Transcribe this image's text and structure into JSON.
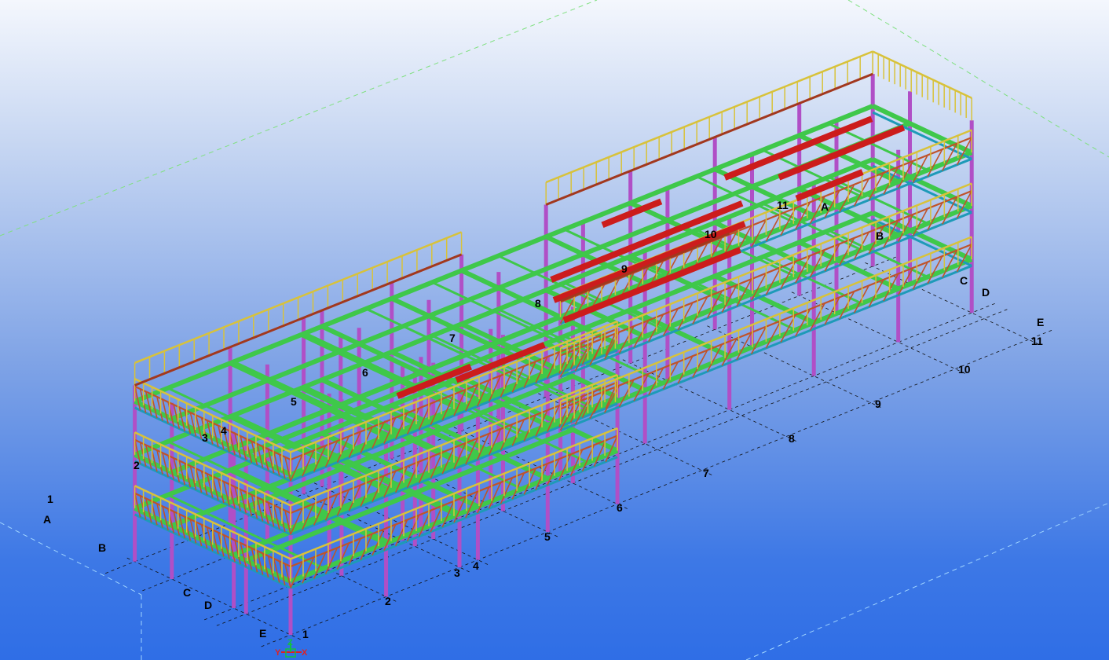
{
  "viewport": {
    "background_top": "#f4f7fd",
    "background_bottom": "#2f6ee6"
  },
  "grid_labels": {
    "front_numbers": [
      "1",
      "2",
      "3",
      "4",
      "5",
      "6",
      "7",
      "8",
      "9",
      "10",
      "11"
    ],
    "front_letters": [
      "A",
      "B",
      "C",
      "D",
      "E"
    ],
    "back_letters": [
      "A",
      "B",
      "C",
      "D",
      "E"
    ],
    "interior_numbers": [
      "2",
      "3",
      "4",
      "5",
      "6",
      "7",
      "8",
      "9",
      "10",
      "11"
    ],
    "left_number": "1"
  },
  "member_colors": {
    "columns": "#b04fc6",
    "beams": "#3fc84a",
    "primary_beams": "#cc1c1c",
    "edge_beams": "#1e9ab8",
    "handrails": "#d8c23a",
    "trusses": "#c0532a",
    "parapet": "#a2381e"
  },
  "axis_gizmo": {
    "x_label": "X",
    "y_label": "Y",
    "z_label": "Z",
    "x_color": "#e02020",
    "y_color": "#e02020",
    "z_color": "#12c040"
  }
}
